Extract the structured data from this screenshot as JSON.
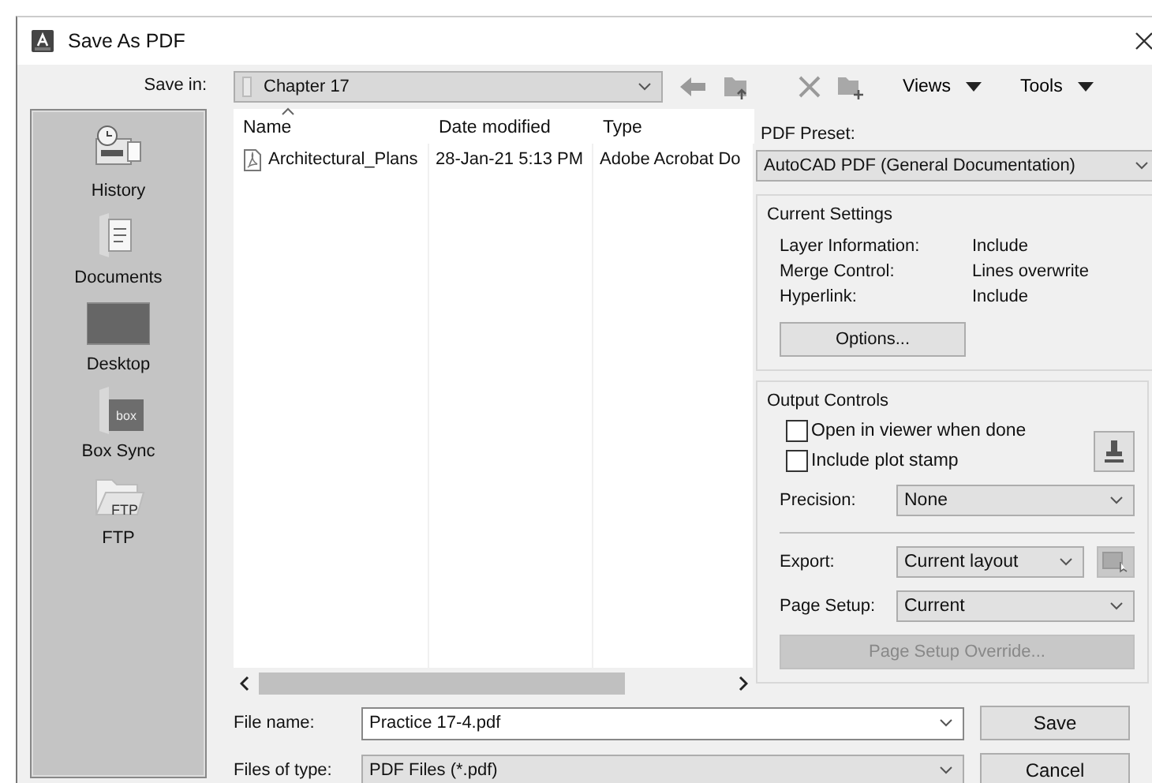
{
  "window": {
    "title": "Save As PDF"
  },
  "toolbar": {
    "save_in_label": "Save in:",
    "folder": "Chapter 17",
    "views": "Views",
    "tools": "Tools"
  },
  "places": [
    {
      "label": "History",
      "kind": "history"
    },
    {
      "label": "Documents",
      "kind": "documents"
    },
    {
      "label": "Desktop",
      "kind": "desktop"
    },
    {
      "label": "Box Sync",
      "kind": "box",
      "icon_text": "box"
    },
    {
      "label": "FTP",
      "kind": "ftp",
      "icon_text": "FTP"
    }
  ],
  "file_list": {
    "columns": [
      {
        "label": "Name",
        "sorted": true
      },
      {
        "label": "Date modified",
        "sorted": false
      },
      {
        "label": "Type",
        "sorted": false
      }
    ],
    "rows": [
      {
        "name": "Architectural_Plans",
        "date": "28-Jan-21 5:13 PM",
        "type": "Adobe Acrobat Do"
      }
    ]
  },
  "file_name": {
    "label": "File name:",
    "value": "Practice 17-4.pdf"
  },
  "file_type": {
    "label": "Files of type:",
    "value": "PDF Files (*.pdf)"
  },
  "buttons": {
    "save": "Save",
    "cancel": "Cancel"
  },
  "pdf_preset": {
    "label": "PDF Preset:",
    "value": "AutoCAD PDF (General Documentation)"
  },
  "current_settings": {
    "title": "Current Settings",
    "rows": [
      {
        "label": "Layer Information:",
        "value": "Include"
      },
      {
        "label": "Merge Control:",
        "value": "Lines overwrite"
      },
      {
        "label": "Hyperlink:",
        "value": "Include"
      }
    ],
    "options_button": "Options..."
  },
  "output_controls": {
    "title": "Output Controls",
    "checkboxes": [
      {
        "label": "Open in viewer when done",
        "checked": false
      },
      {
        "label": "Include plot stamp",
        "checked": false
      }
    ],
    "precision": {
      "label": "Precision:",
      "value": "None"
    },
    "export": {
      "label": "Export:",
      "value": "Current layout"
    },
    "page_setup": {
      "label": "Page Setup:",
      "value": "Current"
    },
    "override_button": {
      "label": "Page Setup Override...",
      "disabled": true
    }
  }
}
